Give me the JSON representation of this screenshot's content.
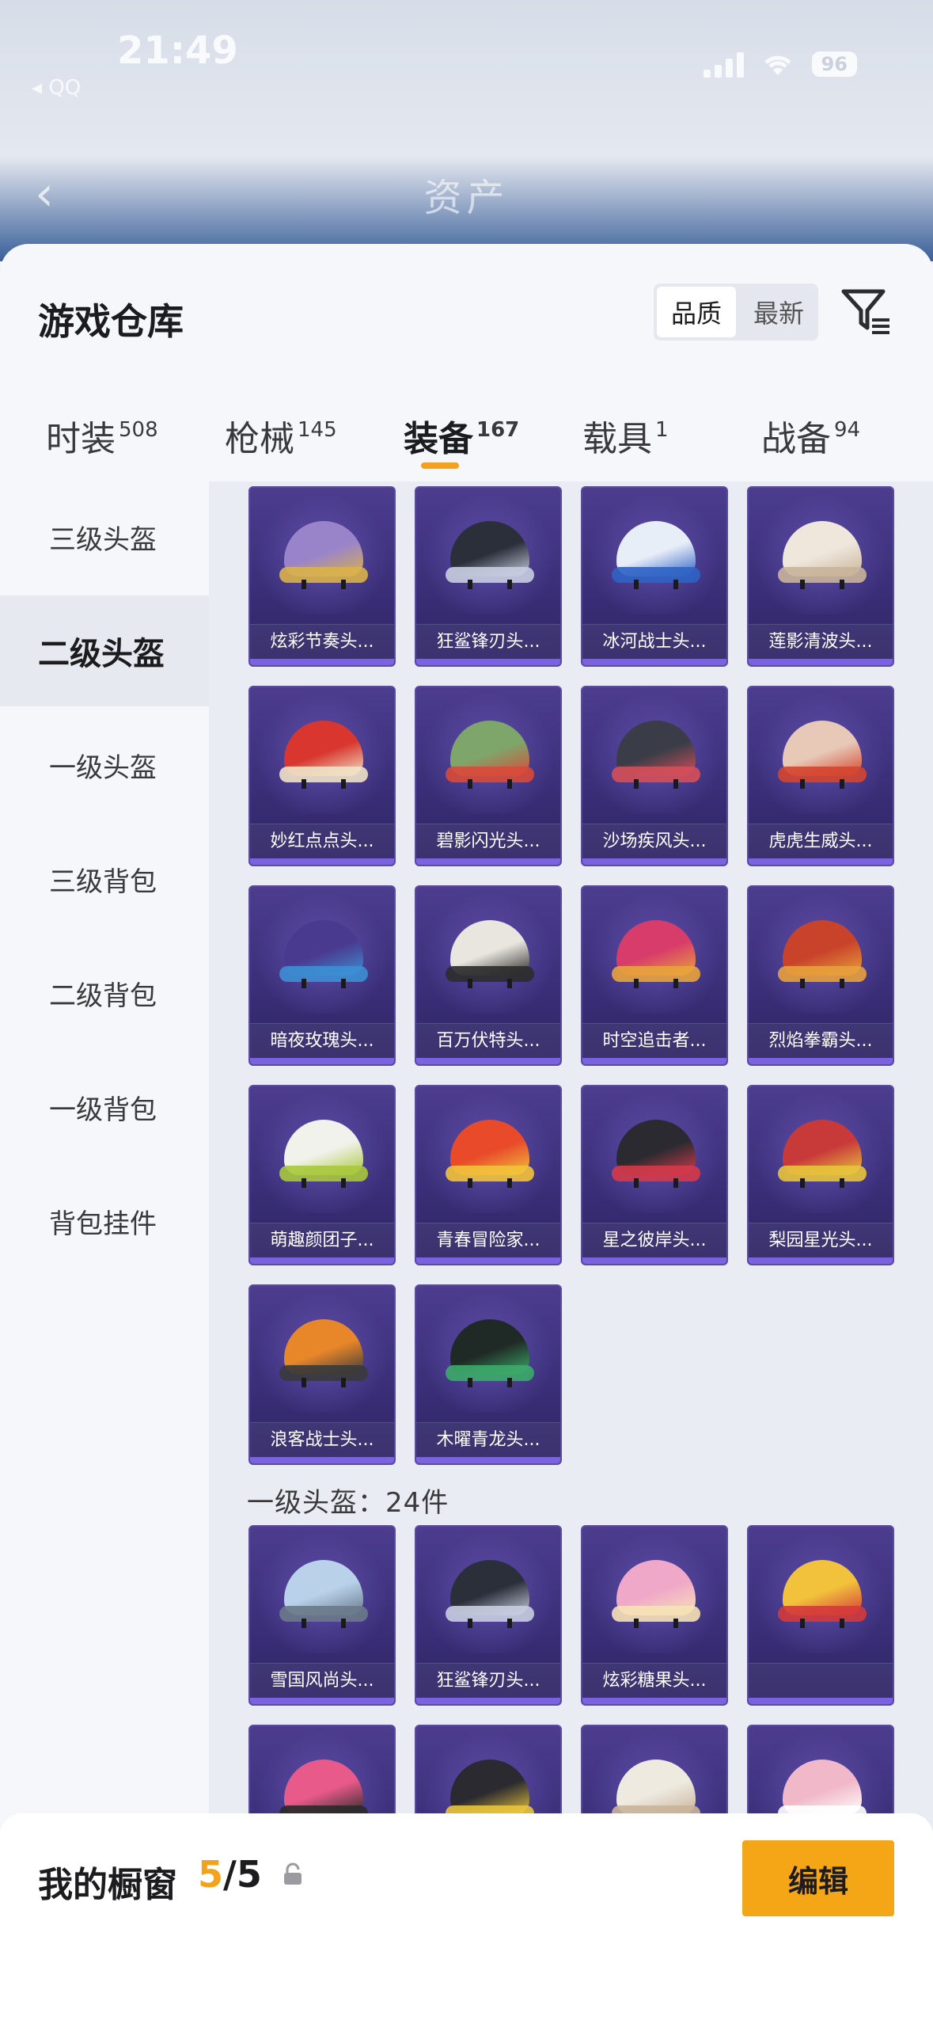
{
  "status_bar": {
    "time": "21:49",
    "back_app": "◂ QQ",
    "battery": "96"
  },
  "nav": {
    "title": "资产"
  },
  "header": {
    "title": "游戏仓库",
    "sort_options": [
      "品质",
      "最新"
    ],
    "sort_selected": "品质"
  },
  "tabs": [
    {
      "label": "时装",
      "count": "508"
    },
    {
      "label": "枪械",
      "count": "145"
    },
    {
      "label": "装备",
      "count": "167",
      "active": true
    },
    {
      "label": "载具",
      "count": "1"
    },
    {
      "label": "战备",
      "count": "94"
    }
  ],
  "sidebar": [
    {
      "label": "三级头盔"
    },
    {
      "label": "二级头盔",
      "active": true
    },
    {
      "label": "一级头盔"
    },
    {
      "label": "三级背包"
    },
    {
      "label": "二级背包"
    },
    {
      "label": "一级背包"
    },
    {
      "label": "背包挂件"
    }
  ],
  "items": [
    {
      "name": "炫彩节奏头...",
      "color": "#9a84c9",
      "accent": "#d9b14a"
    },
    {
      "name": "狂鲨锋刃头...",
      "color": "#2b2f3a",
      "accent": "#c8cde0"
    },
    {
      "name": "冰河战士头...",
      "color": "#e8eef8",
      "accent": "#2f63c4"
    },
    {
      "name": "莲影清波头...",
      "color": "#efe7dc",
      "accent": "#c9b49a"
    },
    {
      "name": "妙红点点头...",
      "color": "#d8362e",
      "accent": "#f0e2c6"
    },
    {
      "name": "碧影闪光头...",
      "color": "#7fa66a",
      "accent": "#d84a3a"
    },
    {
      "name": "沙场疾风头...",
      "color": "#3a3d47",
      "accent": "#d44f5a"
    },
    {
      "name": "虎虎生威头...",
      "color": "#e8c9b8",
      "accent": "#d4452f"
    },
    {
      "name": "暗夜玫瑰头...",
      "color": "#4a3a8f",
      "accent": "#3c8fd4"
    },
    {
      "name": "百万伏特头...",
      "color": "#e8e6df",
      "accent": "#2c2c2c"
    },
    {
      "name": "时空追击者...",
      "color": "#d83c6a",
      "accent": "#e8a33c"
    },
    {
      "name": "烈焰拳霸头...",
      "color": "#c8432a",
      "accent": "#e8a03c"
    },
    {
      "name": "萌趣颜团子...",
      "color": "#f2f2ec",
      "accent": "#a8c83c"
    },
    {
      "name": "青春冒险家...",
      "color": "#e84a2a",
      "accent": "#f2c23c"
    },
    {
      "name": "星之彼岸头...",
      "color": "#2a2a30",
      "accent": "#d43a4a"
    },
    {
      "name": "梨园星光头...",
      "color": "#c83a3a",
      "accent": "#e8c43c"
    },
    {
      "name": "浪客战士头...",
      "color": "#e8862a",
      "accent": "#3a3a3a"
    },
    {
      "name": "木曜青龙头...",
      "color": "#1f2a26",
      "accent": "#3caa6a"
    }
  ],
  "section_level1": {
    "title": "一级头盔：24件"
  },
  "items_level1": [
    {
      "name": "雪国风尚头...",
      "color": "#b9d2ea",
      "accent": "#6a7a8a"
    },
    {
      "name": "狂鲨锋刃头...",
      "color": "#2b2f3a",
      "accent": "#c8cde0"
    },
    {
      "name": "炫彩糖果头...",
      "color": "#f0a8c8",
      "accent": "#f6e2b6"
    },
    {
      "name": "",
      "color": "#f2c23c",
      "accent": "#d43a3a"
    },
    {
      "name": "",
      "color": "#e85a8a",
      "accent": "#2a2a2a"
    },
    {
      "name": "",
      "color": "#2a2a30",
      "accent": "#e8c43c"
    },
    {
      "name": "",
      "color": "#eeeae0",
      "accent": "#c9b49a"
    },
    {
      "name": "",
      "color": "#f0b8c8",
      "accent": "#ffffff"
    }
  ],
  "bottom_bar": {
    "label": "我的橱窗",
    "current": "5",
    "total": "/5",
    "edit_button": "编辑"
  }
}
